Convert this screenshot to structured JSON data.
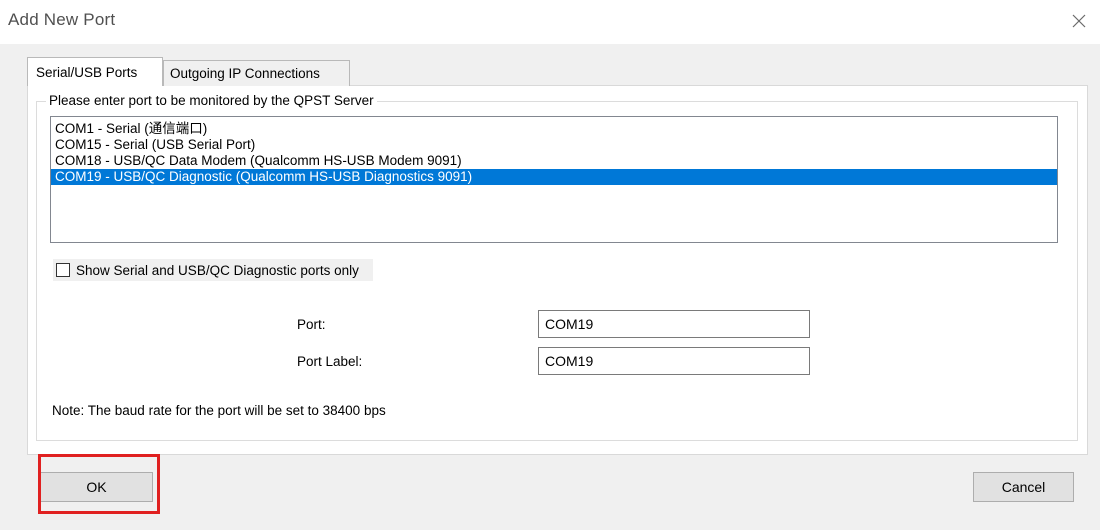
{
  "window": {
    "title": "Add New Port",
    "close_icon": "close-icon"
  },
  "tabs": [
    {
      "label": "Serial/USB Ports",
      "active": true
    },
    {
      "label": "Outgoing IP Connections",
      "active": false
    }
  ],
  "group": {
    "legend": "Please enter port to be monitored by the QPST Server"
  },
  "ports_list": {
    "items": [
      {
        "label": "COM1 - Serial (通信端口)",
        "selected": false
      },
      {
        "label": "COM15 - Serial (USB Serial Port)",
        "selected": false
      },
      {
        "label": "COM18 - USB/QC Data Modem (Qualcomm HS-USB Modem 9091)",
        "selected": false
      },
      {
        "label": "COM19 - USB/QC Diagnostic (Qualcomm HS-USB Diagnostics 9091)",
        "selected": true
      }
    ]
  },
  "filter_checkbox": {
    "label": "Show Serial and USB/QC Diagnostic ports only",
    "checked": false
  },
  "port_field": {
    "label": "Port:",
    "value": "COM19"
  },
  "port_label_field": {
    "label": "Port Label:",
    "value": "COM19"
  },
  "note": "Note: The baud rate for the port will be set to 38400 bps",
  "buttons": {
    "ok": "OK",
    "cancel": "Cancel"
  },
  "colors": {
    "selection": "#0078d7",
    "highlight_box": "#e02020",
    "dialog_bg": "#f0f0f0"
  }
}
